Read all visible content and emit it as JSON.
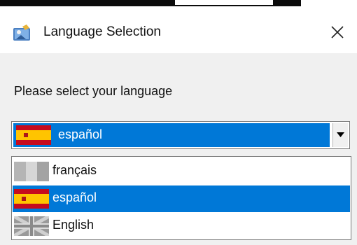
{
  "window": {
    "title": "Language Selection",
    "app_icon": "duke-app-icon",
    "close_icon": "close-icon"
  },
  "dialog": {
    "prompt": "Please select your language"
  },
  "language_select": {
    "selected_value": "español",
    "dropdown_icon": "chevron-down-icon",
    "options": [
      {
        "label": "français",
        "flag": "flag-greyed-icon",
        "highlighted": false
      },
      {
        "label": "español",
        "flag": "flag-spain-icon",
        "highlighted": true
      },
      {
        "label": "English",
        "flag": "flag-uk-greyed-icon",
        "highlighted": false
      }
    ]
  },
  "colors": {
    "selection": "#0078d7",
    "window_bg": "#f0f0f0",
    "titlebar_bg": "#ffffff"
  }
}
